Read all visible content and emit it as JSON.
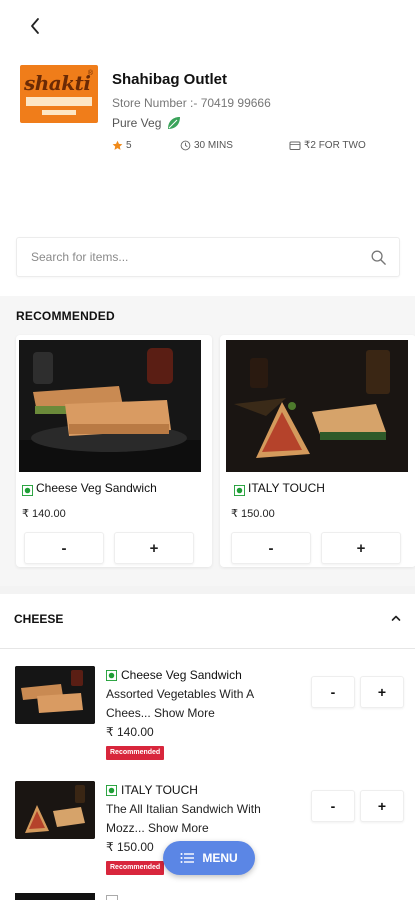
{
  "store": {
    "name": "Shahibag Outlet",
    "store_number": "Store Number :- 70419 99666",
    "diet": "Pure Veg",
    "rating": "5",
    "delivery_time": "30 MINS",
    "cost_for_two": "₹2 FOR TWO",
    "logo_text": "shakti",
    "logo_tagline": "THE SANDWICH SHOP"
  },
  "search": {
    "placeholder": "Search for items..."
  },
  "recommended": {
    "title": "RECOMMENDED",
    "items": [
      {
        "name": "Cheese Veg Sandwich",
        "price": "₹ 140.00",
        "minus": "-",
        "plus": "+"
      },
      {
        "name": "ITALY TOUCH",
        "price": "₹ 150.00",
        "minus": "-",
        "plus": "+"
      }
    ]
  },
  "category": {
    "title": "CHEESE",
    "items": [
      {
        "name": "Cheese Veg Sandwich",
        "desc_line1": "Assorted Vegetables With A",
        "desc_line2": "Chees...",
        "show_more": "Show More",
        "price": "₹ 140.00",
        "badge": "Recommended",
        "minus": "-",
        "plus": "+"
      },
      {
        "name": "ITALY TOUCH",
        "desc_line1": "The All Italian Sandwich With",
        "desc_line2": "Mozz...",
        "show_more": "Show More",
        "price": "₹ 150.00",
        "badge": "Recommended",
        "minus": "-",
        "plus": "+"
      }
    ]
  },
  "fab": {
    "label": "MENU"
  },
  "colors": {
    "accent": "#5b86e5",
    "badge": "#d8263c",
    "veg": "#1e9e35",
    "star": "#f08a1a",
    "brand": "#f07d1a"
  },
  "icons": [
    "back-arrow-icon",
    "leaf-icon",
    "star-icon",
    "clock-icon",
    "wallet-icon",
    "search-icon",
    "chevron-up-icon",
    "menu-list-icon"
  ]
}
